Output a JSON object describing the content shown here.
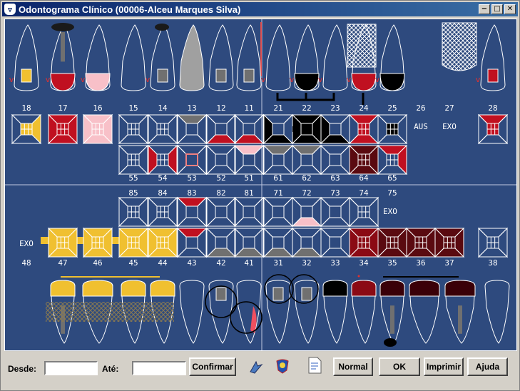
{
  "window": {
    "title": "Odontograma Clínico (00006-Alceu Marques Silva)"
  },
  "teeth_upper_perm": [
    "18",
    "17",
    "16",
    "15",
    "14",
    "13",
    "12",
    "11",
    "21",
    "22",
    "23",
    "24",
    "25",
    "26",
    "27",
    "28"
  ],
  "teeth_upper_dec": [
    "55",
    "54",
    "53",
    "52",
    "51",
    "61",
    "62",
    "63",
    "64",
    "65"
  ],
  "teeth_lower_dec": [
    "85",
    "84",
    "83",
    "82",
    "81",
    "71",
    "72",
    "73",
    "74",
    "75"
  ],
  "teeth_lower_perm": [
    "48",
    "47",
    "46",
    "45",
    "44",
    "43",
    "42",
    "41",
    "31",
    "32",
    "33",
    "34",
    "35",
    "36",
    "37",
    "38"
  ],
  "status": {
    "t26": "AUS",
    "t27": "EXO",
    "t75": "EXO",
    "t48": "EXO"
  },
  "colors": {
    "background": "#2e4a7e",
    "yellow": "#f0c030",
    "red": "#c01020",
    "pink": "#f8c0c8",
    "black": "#000000",
    "darkred": "#5a0a10",
    "grey": "#707070",
    "maroon": "#8b0a14"
  },
  "bottom": {
    "desde_label": "Desde:",
    "desde_value": "",
    "ate_label": "Até:",
    "ate_value": "",
    "confirm_label": "Confirmar",
    "normal_label": "Normal",
    "ok_label": "OK",
    "print_label": "Imprimir",
    "help_label": "Ajuda"
  }
}
